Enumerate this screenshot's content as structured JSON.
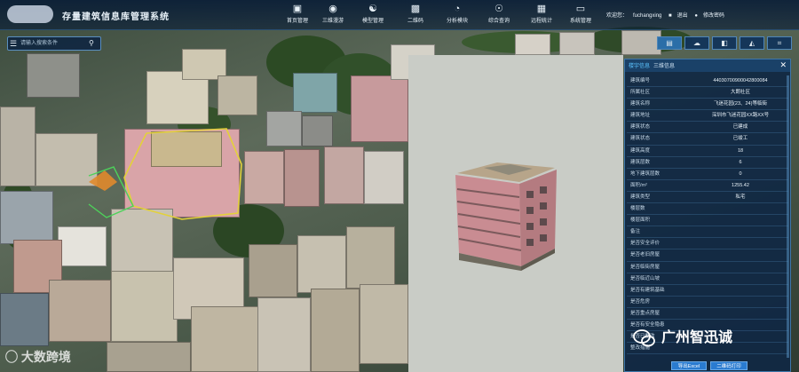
{
  "header": {
    "title": "存量建筑信息库管理系统",
    "nav": [
      {
        "label": "首页管理",
        "icon": "briefcase-icon"
      },
      {
        "label": "三维漫游",
        "icon": "globe-icon"
      },
      {
        "label": "模型管理",
        "icon": "database-icon"
      },
      {
        "label": "二维码",
        "icon": "qr-code-icon"
      },
      {
        "label": "分析模块",
        "icon": "pie-chart-icon"
      },
      {
        "label": "综合查询",
        "icon": "search-people-icon"
      },
      {
        "label": "远程统计",
        "icon": "table-icon"
      },
      {
        "label": "系统管理",
        "icon": "monitor-icon"
      }
    ],
    "greeting": "欢迎您：",
    "username": "fuchangxing",
    "logout": "退出",
    "change_password": "修改密码"
  },
  "search": {
    "placeholder": "请输入搜索条件"
  },
  "tools": [
    {
      "name": "layers-tool",
      "glyph": "▤"
    },
    {
      "name": "cloud-tool",
      "glyph": "☁"
    },
    {
      "name": "cube-tool",
      "glyph": "◧"
    },
    {
      "name": "measure-tool",
      "glyph": "◭"
    },
    {
      "name": "crop-tool",
      "glyph": "⌗"
    }
  ],
  "panel": {
    "tabs": [
      "楼宇信息",
      "三维信息"
    ],
    "rows": [
      {
        "key": "建筑编号",
        "value": "44030700900042800084"
      },
      {
        "key": "所属社区",
        "value": "大朗社区"
      },
      {
        "key": "建筑名称",
        "value": "飞迷花园(23、24)等临街"
      },
      {
        "key": "建筑地址",
        "value": "深圳市飞迷花园XX路XX号"
      },
      {
        "key": "建筑状态",
        "value": "已建成"
      },
      {
        "key": "建筑状态",
        "value": "已竣工"
      },
      {
        "key": "建筑高度",
        "value": "18"
      },
      {
        "key": "建筑层数",
        "value": "6"
      },
      {
        "key": "地下建筑层数",
        "value": "0"
      },
      {
        "key": "面积/m²",
        "value": "1255.42"
      },
      {
        "key": "建筑类型",
        "value": "私宅"
      },
      {
        "key": "楼层数",
        "value": ""
      },
      {
        "key": "楼层面积",
        "value": ""
      },
      {
        "key": "备注",
        "value": ""
      },
      {
        "key": "是否安全评价",
        "value": ""
      },
      {
        "key": "是否老旧房屋",
        "value": ""
      },
      {
        "key": "是否临街房屋",
        "value": ""
      },
      {
        "key": "是否临近山坡",
        "value": ""
      },
      {
        "key": "是否有建筑基础",
        "value": ""
      },
      {
        "key": "是否危房",
        "value": ""
      },
      {
        "key": "是否重点房屋",
        "value": ""
      },
      {
        "key": "是否有安全隐患",
        "value": ""
      },
      {
        "key": "是否已整改",
        "value": ""
      },
      {
        "key": "整改措施",
        "value": ""
      }
    ],
    "export_excel": "导出Excel",
    "print_qr": "二维码打印"
  },
  "watermarks": {
    "left": "大数跨境",
    "right": "广州智迅诚"
  }
}
